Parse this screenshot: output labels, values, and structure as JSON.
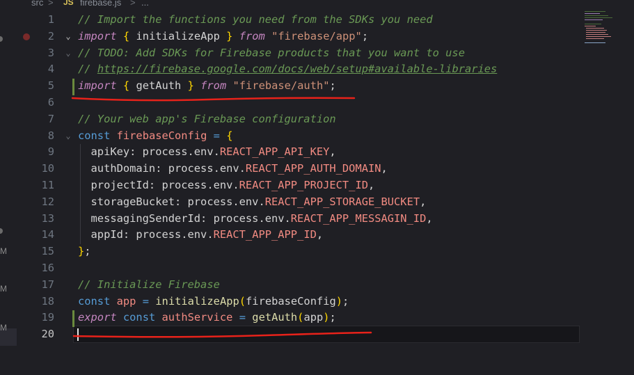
{
  "breadcrumb": {
    "folder": "src",
    "separator": ">",
    "file_icon": "JS",
    "file": "firebase.js",
    "more": "..."
  },
  "gutter_markers": [
    "M",
    "M",
    "M"
  ],
  "colors": {
    "background": "#1f1f24",
    "comment": "#6a9955",
    "keyword": "#569cd6",
    "function": "#dcdcaa",
    "string": "#ce9178",
    "env_constant": "#f28b82",
    "annotation_underline": "#e8221a"
  },
  "editor": {
    "active_line": 20,
    "lines": [
      {
        "n": "1",
        "tokens": [
          {
            "t": "// Import the functions you need from the SDKs you need",
            "c": "cm"
          }
        ]
      },
      {
        "n": "2",
        "tokens": [
          {
            "t": "import",
            "c": "kw-ctrl"
          },
          {
            "t": " ",
            "c": "plain"
          },
          {
            "t": "{",
            "c": "br1"
          },
          {
            "t": " initializeApp ",
            "c": "plain"
          },
          {
            "t": "}",
            "c": "br1"
          },
          {
            "t": " ",
            "c": "plain"
          },
          {
            "t": "from",
            "c": "kw-ctrl"
          },
          {
            "t": " ",
            "c": "plain"
          },
          {
            "t": "\"firebase/app\"",
            "c": "str"
          },
          {
            "t": ";",
            "c": "plain"
          }
        ]
      },
      {
        "n": "3",
        "tokens": [
          {
            "t": "// TODO: Add SDKs for Firebase products that you want to use",
            "c": "cm"
          }
        ]
      },
      {
        "n": "4",
        "tokens": [
          {
            "t": "// ",
            "c": "cm"
          },
          {
            "t": "https://firebase.google.com/docs/web/setup#available-libraries",
            "c": "link"
          }
        ]
      },
      {
        "n": "5",
        "tokens": [
          {
            "t": "import",
            "c": "kw-ctrl"
          },
          {
            "t": " ",
            "c": "plain"
          },
          {
            "t": "{",
            "c": "br1"
          },
          {
            "t": " getAuth ",
            "c": "plain"
          },
          {
            "t": "}",
            "c": "br1"
          },
          {
            "t": " ",
            "c": "plain"
          },
          {
            "t": "from",
            "c": "kw-ctrl"
          },
          {
            "t": " ",
            "c": "plain"
          },
          {
            "t": "\"firebase/auth\"",
            "c": "str"
          },
          {
            "t": ";",
            "c": "plain"
          }
        ]
      },
      {
        "n": "6",
        "tokens": []
      },
      {
        "n": "7",
        "tokens": [
          {
            "t": "// Your web app's Firebase configuration",
            "c": "cm"
          }
        ]
      },
      {
        "n": "8",
        "tokens": [
          {
            "t": "const",
            "c": "kw"
          },
          {
            "t": " ",
            "c": "plain"
          },
          {
            "t": "firebaseConfig",
            "c": "cst"
          },
          {
            "t": " ",
            "c": "plain"
          },
          {
            "t": "=",
            "c": "kw"
          },
          {
            "t": " ",
            "c": "plain"
          },
          {
            "t": "{",
            "c": "br1"
          }
        ]
      },
      {
        "n": "9",
        "tokens": [
          {
            "t": "  apiKey: process.env.",
            "c": "plain"
          },
          {
            "t": "REACT_APP_API_KEY",
            "c": "cst"
          },
          {
            "t": ",",
            "c": "plain"
          }
        ]
      },
      {
        "n": "10",
        "tokens": [
          {
            "t": "  authDomain: process.env.",
            "c": "plain"
          },
          {
            "t": "REACT_APP_AUTH_DOMAIN",
            "c": "cst"
          },
          {
            "t": ",",
            "c": "plain"
          }
        ]
      },
      {
        "n": "11",
        "tokens": [
          {
            "t": "  projectId: process.env.",
            "c": "plain"
          },
          {
            "t": "REACT_APP_PROJECT_ID",
            "c": "cst"
          },
          {
            "t": ",",
            "c": "plain"
          }
        ]
      },
      {
        "n": "12",
        "tokens": [
          {
            "t": "  storageBucket: process.env.",
            "c": "plain"
          },
          {
            "t": "REACT_APP_STORAGE_BUCKET",
            "c": "cst"
          },
          {
            "t": ",",
            "c": "plain"
          }
        ]
      },
      {
        "n": "13",
        "tokens": [
          {
            "t": "  messagingSenderId: process.env.",
            "c": "plain"
          },
          {
            "t": "REACT_APP_MESSAGIN_ID",
            "c": "cst"
          },
          {
            "t": ",",
            "c": "plain"
          }
        ]
      },
      {
        "n": "14",
        "tokens": [
          {
            "t": "  appId: process.env.",
            "c": "plain"
          },
          {
            "t": "REACT_APP_APP_ID",
            "c": "cst"
          },
          {
            "t": ",",
            "c": "plain"
          }
        ]
      },
      {
        "n": "15",
        "tokens": [
          {
            "t": "}",
            "c": "br1"
          },
          {
            "t": ";",
            "c": "plain"
          }
        ]
      },
      {
        "n": "16",
        "tokens": []
      },
      {
        "n": "17",
        "tokens": [
          {
            "t": "// Initialize Firebase",
            "c": "cm"
          }
        ]
      },
      {
        "n": "18",
        "tokens": [
          {
            "t": "const",
            "c": "kw"
          },
          {
            "t": " ",
            "c": "plain"
          },
          {
            "t": "app",
            "c": "cst"
          },
          {
            "t": " ",
            "c": "plain"
          },
          {
            "t": "=",
            "c": "kw"
          },
          {
            "t": " ",
            "c": "plain"
          },
          {
            "t": "initializeApp",
            "c": "fn"
          },
          {
            "t": "(",
            "c": "br1"
          },
          {
            "t": "firebaseConfig",
            "c": "plain"
          },
          {
            "t": ")",
            "c": "br1"
          },
          {
            "t": ";",
            "c": "plain"
          }
        ]
      },
      {
        "n": "19",
        "tokens": [
          {
            "t": "export",
            "c": "kw-ctrl"
          },
          {
            "t": " ",
            "c": "plain"
          },
          {
            "t": "const",
            "c": "kw"
          },
          {
            "t": " ",
            "c": "plain"
          },
          {
            "t": "authService",
            "c": "cst"
          },
          {
            "t": " ",
            "c": "plain"
          },
          {
            "t": "=",
            "c": "kw"
          },
          {
            "t": " ",
            "c": "plain"
          },
          {
            "t": "getAuth",
            "c": "fn"
          },
          {
            "t": "(",
            "c": "br1"
          },
          {
            "t": "app",
            "c": "plain"
          },
          {
            "t": ")",
            "c": "br1"
          },
          {
            "t": ";",
            "c": "plain"
          }
        ]
      },
      {
        "n": "20",
        "tokens": []
      }
    ]
  }
}
